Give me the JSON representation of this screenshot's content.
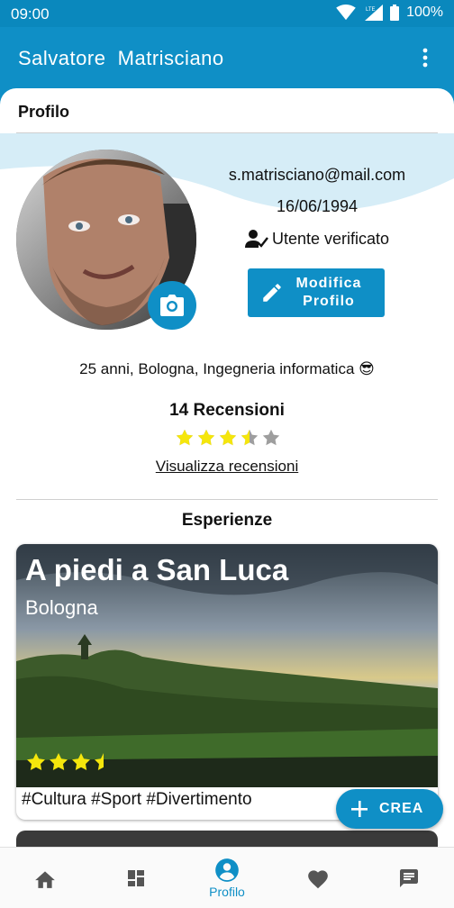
{
  "status_bar": {
    "time": "09:00",
    "network": "LTE",
    "battery": "100%"
  },
  "app_bar": {
    "title": "Salvatore  Matrisciano",
    "menu_icon": "more-vert-icon"
  },
  "profile": {
    "section_title": "Profilo",
    "email": "s.matrisciano@mail.com",
    "birth_date": "16/06/1994",
    "verified_label": "Utente verificato",
    "edit_button_line1": "Modifica",
    "edit_button_line2": "Profilo",
    "bio": "25 anni, Bologna, Ingegneria informatica 😎",
    "reviews_count": "14 Recensioni",
    "rating": 3.5,
    "rating_max": 5,
    "reviews_link": "Visualizza recensioni"
  },
  "experiences": {
    "title": "Esperienze",
    "items": [
      {
        "title": "A piedi a San Luca",
        "location": "Bologna",
        "rating": 3.5,
        "tags": "#Cultura #Sport #Divertimento"
      }
    ]
  },
  "fab": {
    "label": "CREA"
  },
  "bottom_nav": {
    "items": [
      {
        "icon": "home-icon",
        "label": ""
      },
      {
        "icon": "dashboard-icon",
        "label": ""
      },
      {
        "icon": "account-circle-icon",
        "label": "Profilo",
        "active": true
      },
      {
        "icon": "heart-icon",
        "label": ""
      },
      {
        "icon": "chat-icon",
        "label": ""
      }
    ]
  },
  "colors": {
    "primary": "#0f8fc6",
    "star": "#f5e60c",
    "star_empty": "#9e9e9e"
  }
}
